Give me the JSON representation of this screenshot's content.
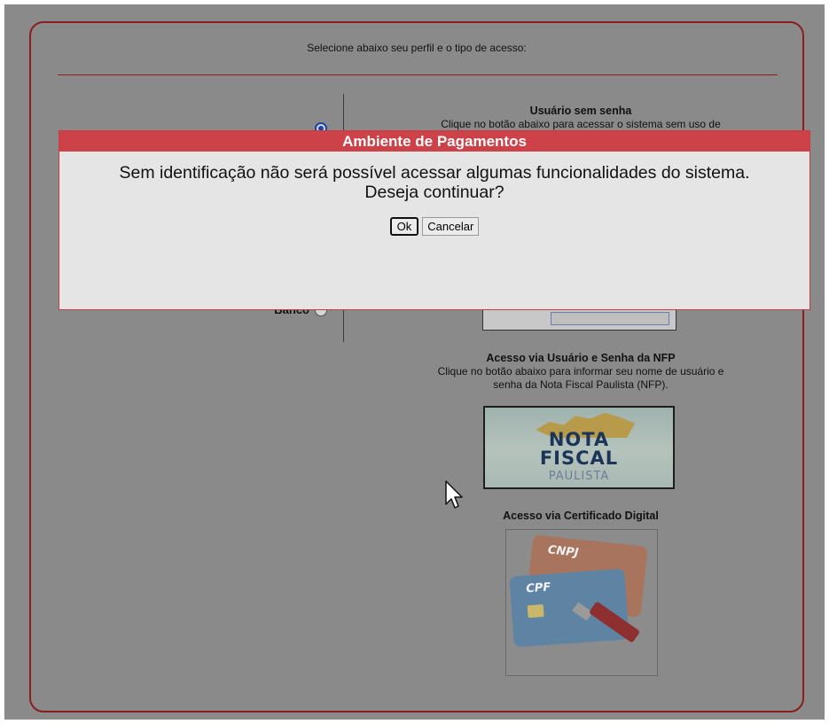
{
  "panel": {
    "title": "Selecione abaixo seu perfil e o tipo de acesso:"
  },
  "profiles": [
    {
      "label": "",
      "selected": true
    },
    {
      "label": "Banco",
      "selected": false
    }
  ],
  "sections": {
    "no_password": {
      "title": "Usuário sem senha",
      "description": "Clique no botão abaixo para acessar o sistema sem uso de"
    },
    "nfp": {
      "title": "Acesso via Usuário e Senha da NFP",
      "description_line1": "Clique no botão abaixo para informar seu nome de usuário e",
      "description_line2": "senha da Nota Fiscal Paulista (NFP).",
      "logo_line1": "NOTA",
      "logo_line2": "FISCAL",
      "logo_line3": "PAULISTA"
    },
    "certificate": {
      "title": "Acesso via Certificado Digital",
      "card_top": "CNPJ",
      "card_bottom": "CPF"
    }
  },
  "modal": {
    "title": "Ambiente de Pagamentos",
    "message_line1": "Sem identificação não será possível acessar algumas funcionalidades do sistema.",
    "message_line2": "Deseja continuar?",
    "ok_label": "Ok",
    "cancel_label": "Cancelar"
  },
  "colors": {
    "border_red": "#8b1d1d",
    "modal_header": "#cc4248",
    "overlay_gray": "#8a8a8a"
  }
}
